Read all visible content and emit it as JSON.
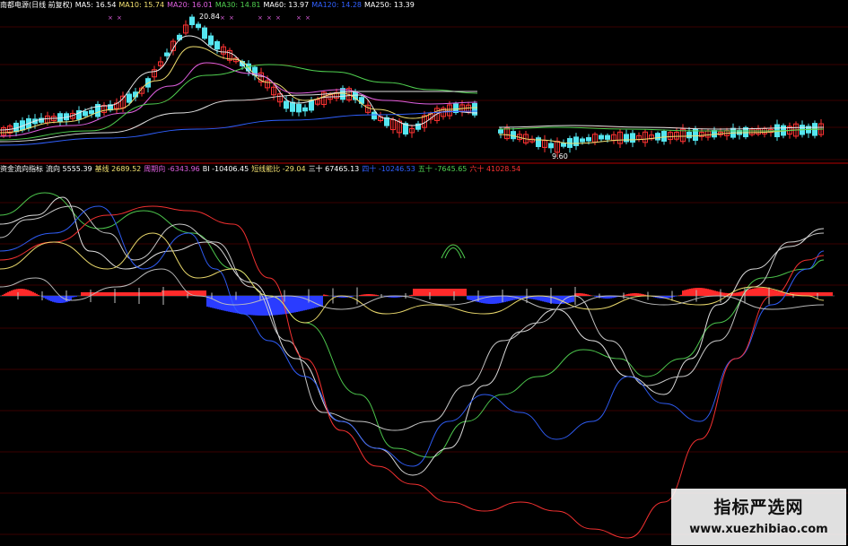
{
  "colors": {
    "background": "#000000",
    "grid": "#3a0000",
    "divider": "#7a0000",
    "candle_up": "#ff3333",
    "candle_down": "#55e6f0",
    "ma5": "#e8e8e8",
    "ma10": "#f2e070",
    "ma20": "#e060e0",
    "ma30": "#50d050",
    "ma60": "#3060ff",
    "ma250": "#e0e0e0",
    "hist_pos": "#ff2a2a",
    "hist_neg": "#2a3cff"
  },
  "price_panel": {
    "legend": [
      {
        "text": "南都电源(日线 前复权)",
        "color": "#ffffff"
      },
      {
        "text": "MA5: 16.54",
        "color": "#ffffff"
      },
      {
        "text": "MA10: 15.74",
        "color": "#f2e070"
      },
      {
        "text": "MA20: 16.01",
        "color": "#e060e0"
      },
      {
        "text": "MA30: 14.81",
        "color": "#50d050"
      },
      {
        "text": "MA60: 13.97",
        "color": "#ffffff"
      },
      {
        "text": "MA120: 14.28",
        "color": "#3060ff"
      },
      {
        "text": "MA250: 13.39",
        "color": "#ffffff"
      }
    ],
    "high_label": "20.84",
    "low_label": "9.60"
  },
  "indicator_panel": {
    "legend": [
      {
        "text": "资金流向指标",
        "color": "#ffffff"
      },
      {
        "text": "流向 5555.39",
        "color": "#ffffff"
      },
      {
        "text": "基线 2689.52",
        "color": "#f2e070"
      },
      {
        "text": "周期向 -6343.96",
        "color": "#e060e0"
      },
      {
        "text": "BI -10406.45",
        "color": "#ffffff"
      },
      {
        "text": "短线能比 -29.04",
        "color": "#f2e070"
      },
      {
        "text": "三十 67465.13",
        "color": "#ffffff"
      },
      {
        "text": "四十 -10246.53",
        "color": "#3060ff"
      },
      {
        "text": "五十 -7645.65",
        "color": "#50d050"
      },
      {
        "text": "六十 41028.54",
        "color": "#ff3333"
      }
    ]
  },
  "watermark": {
    "title": "指标严选网",
    "url": "www.xuezhibiao.com"
  }
}
